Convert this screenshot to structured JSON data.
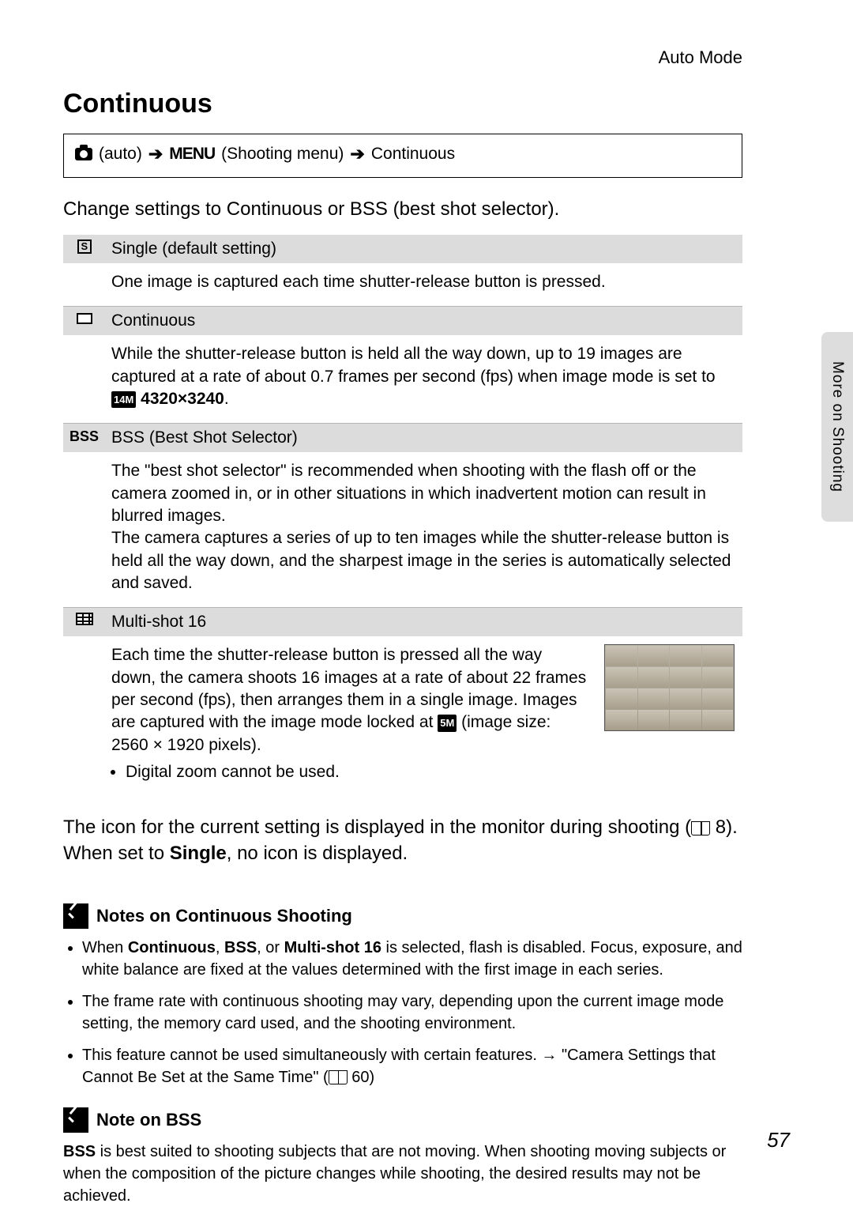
{
  "header": {
    "mode": "Auto Mode"
  },
  "title": "Continuous",
  "breadcrumb": {
    "auto": "(auto)",
    "menu": "MENU",
    "shooting_menu": "(Shooting menu)",
    "leaf": "Continuous"
  },
  "intro": "Change settings to Continuous or BSS (best shot selector).",
  "options": {
    "single": {
      "label": "Single (default setting)",
      "desc": "One image is captured each time shutter-release button is pressed."
    },
    "continuous": {
      "label": "Continuous",
      "desc_a": "While the shutter-release button is held all the way down, up to 19 images are captured at a rate of about 0.7 frames per second (fps) when image mode is set to ",
      "mode_badge": "14M",
      "mode_text": "4320×3240",
      "desc_b": "."
    },
    "bss": {
      "icon_text": "BSS",
      "label": "BSS (Best Shot Selector)",
      "desc": "The \"best shot selector\" is recommended when shooting with the flash off or the camera zoomed in, or in other situations in which inadvertent motion can result in blurred images.\nThe camera captures a series of up to ten images while the shutter-release button is held all the way down, and the sharpest image in the series is automatically selected and saved."
    },
    "multishot": {
      "label": "Multi-shot 16",
      "desc_a": "Each time the shutter-release button is pressed all the way down, the camera shoots 16 images at a rate of about 22 frames per second (fps), then arranges them in a single image. Images are captured with the image mode locked at ",
      "mode_badge": "5M",
      "desc_b": " (image size: 2560 × 1920 pixels).",
      "bullet1": "Digital zoom cannot be used."
    }
  },
  "after_a": "The icon for the current setting is displayed in the monitor during shooting (",
  "after_ref": " 8).",
  "after_b1": "When set to ",
  "after_single": "Single",
  "after_b2": ", no icon is displayed.",
  "notes1": {
    "title": "Notes on Continuous Shooting",
    "li1_a": "When ",
    "li1_cont": "Continuous",
    "li1_b": ", ",
    "li1_bss": "BSS",
    "li1_c": ", or ",
    "li1_ms": "Multi-shot 16",
    "li1_d": " is selected, flash is disabled. Focus, exposure, and white balance are fixed at the values determined with the first image in each series.",
    "li2": "The frame rate with continuous shooting may vary, depending upon the current image mode setting, the memory card used, and the shooting environment.",
    "li3_a": "This feature cannot be used simultaneously with certain features. → \"Camera Settings that Cannot Be Set at the Same Time\" (",
    "li3_b": " 60)"
  },
  "notes2": {
    "title": "Note on BSS",
    "body_a": "BSS",
    "body_b": " is best suited to shooting subjects that are not moving. When shooting moving subjects or when the composition of the picture changes while shooting, the desired results may not be achieved."
  },
  "side_tab": "More on Shooting",
  "page_number": "57"
}
